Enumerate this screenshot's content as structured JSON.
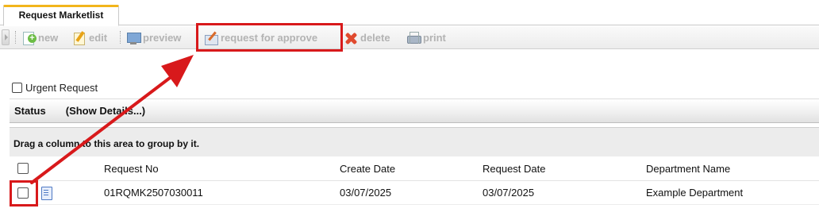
{
  "tab": {
    "label": "Request Marketlist"
  },
  "toolbar": {
    "new_label": "new",
    "edit_label": "edit",
    "preview_label": "preview",
    "request_for_approve_label": "request for approve",
    "delete_label": "delete",
    "print_label": "print",
    "icons": [
      "new-document-icon",
      "edit-icon",
      "monitor-preview-icon",
      "request-approve-icon",
      "delete-x-icon",
      "printer-icon"
    ]
  },
  "urgent_request": {
    "label": "Urgent Request",
    "checked": false
  },
  "status_bar": {
    "label": "Status",
    "show_details_label": "(Show Details...)"
  },
  "group_panel": {
    "text": "Drag a column to this area to group by it."
  },
  "grid": {
    "columns": [
      "Request No",
      "Create Date",
      "Request Date",
      "Department Name"
    ],
    "rows": [
      {
        "request_no": "01RQMK2507030011",
        "create_date": "03/07/2025",
        "request_date": "03/07/2025",
        "department_name": "Example Department",
        "checked": false
      }
    ]
  },
  "annotations": {
    "highlight_color": "#d8191b",
    "highlighted_targets": [
      "request-for-approve-button",
      "row-select-checkbox"
    ]
  },
  "colors": {
    "tab_accent": "#f2b51b",
    "toolbar_text_disabled": "#b3b3b3",
    "delete_icon": "#e04a2f"
  }
}
